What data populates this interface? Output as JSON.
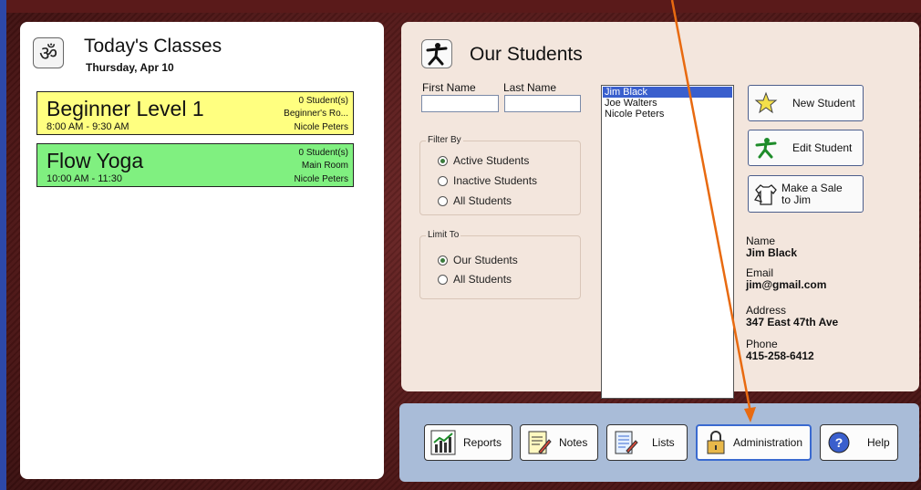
{
  "today": {
    "title": "Today's Classes",
    "date": "Thursday, Apr 10",
    "icon": "om-icon",
    "classes": [
      {
        "name": "Beginner Level 1",
        "time": "8:00 AM - 9:30 AM",
        "students": "0 Student(s)",
        "room": "Beginner's Ro...",
        "instructor": "Nicole Peters",
        "color": "#ffff80"
      },
      {
        "name": "Flow Yoga",
        "time": "10:00 AM - 11:30",
        "students": "0 Student(s)",
        "room": "Main Room",
        "instructor": "Nicole Peters",
        "color": "#80f080"
      }
    ]
  },
  "students": {
    "title": "Our Students",
    "icon": "yoga-pose-icon",
    "first_name_label": "First Name",
    "last_name_label": "Last Name",
    "first_name_value": "",
    "last_name_value": "",
    "filter": {
      "title": "Filter By",
      "options": [
        "Active Students",
        "Inactive Students",
        "All Students"
      ],
      "selected": "Active Students"
    },
    "limit": {
      "title": "Limit To",
      "options": [
        "Our Students",
        "All Students"
      ],
      "selected": "Our Students"
    },
    "list": [
      "Jim Black",
      "Joe Walters",
      "Nicole Peters"
    ],
    "selected": "Jim Black",
    "buttons": {
      "new_student": "New Student",
      "edit_student": "Edit Student",
      "make_sale_line1": "Make a Sale",
      "make_sale_line2": "to Jim"
    },
    "details": {
      "name_label": "Name",
      "name": "Jim Black",
      "email_label": "Email",
      "email": "jim@gmail.com",
      "address_label": "Address",
      "address": "347 East 47th Ave",
      "phone_label": "Phone",
      "phone": "415-258-6412"
    }
  },
  "toolbar": {
    "reports": "Reports",
    "notes": "Notes",
    "lists": "Lists",
    "administration": "Administration",
    "help": "Help"
  },
  "colors": {
    "annotation_arrow": "#e86a10",
    "selection": "#3a5fcd"
  }
}
